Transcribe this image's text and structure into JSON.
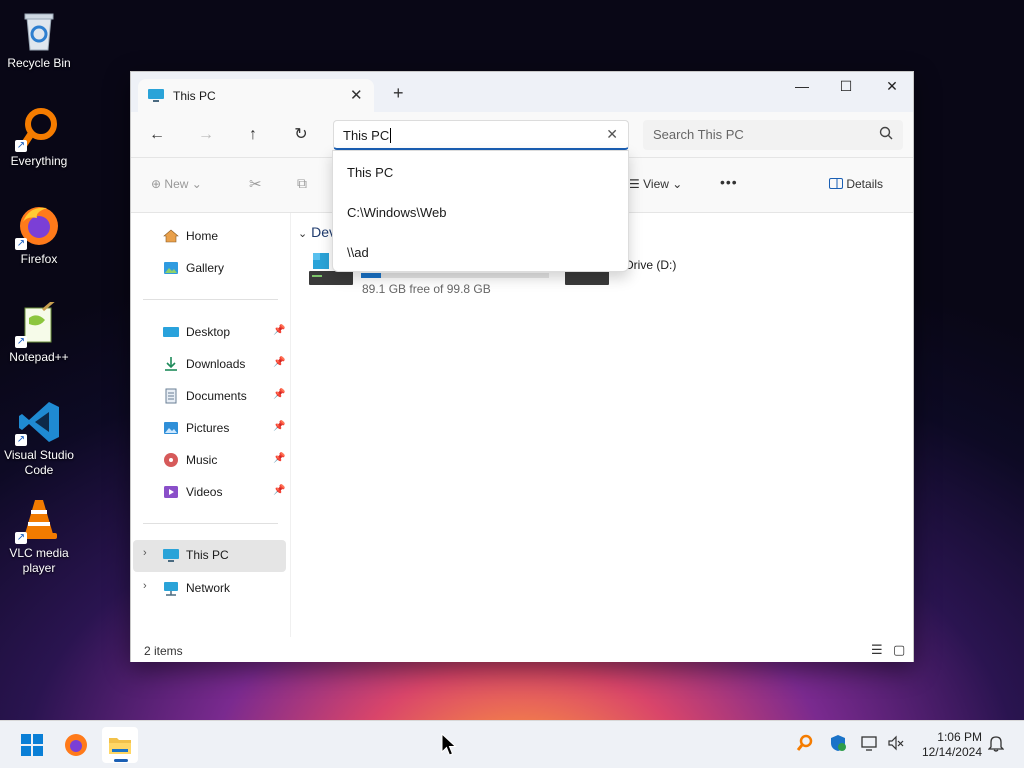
{
  "desktop": {
    "icons": [
      {
        "name": "recycle-bin",
        "label": "Recycle Bin"
      },
      {
        "name": "everything",
        "label": "Everything"
      },
      {
        "name": "firefox",
        "label": "Firefox"
      },
      {
        "name": "notepadpp",
        "label": "Notepad++"
      },
      {
        "name": "vscode",
        "label": "Visual Studio Code"
      },
      {
        "name": "vlc",
        "label": "VLC media player"
      }
    ]
  },
  "window": {
    "tab_title": "This PC",
    "tab_close": "✕",
    "new_tab": "+",
    "controls": {
      "minimize": "—",
      "maximize": "☐",
      "close": "✕"
    },
    "nav": {
      "back": "←",
      "forward": "→",
      "up": "↑",
      "refresh": "↻"
    },
    "address_value": "This PC",
    "address_clear": "✕",
    "search_placeholder": "Search This PC",
    "commands": {
      "new": "New",
      "view": "View",
      "more": "•••",
      "details": "Details"
    },
    "sidebar": {
      "top": [
        {
          "label": "Home",
          "icon": "home-icon"
        },
        {
          "label": "Gallery",
          "icon": "gallery-icon"
        }
      ],
      "pinned": [
        {
          "label": "Desktop",
          "icon": "desktop-folder-icon"
        },
        {
          "label": "Downloads",
          "icon": "downloads-icon"
        },
        {
          "label": "Documents",
          "icon": "documents-icon"
        },
        {
          "label": "Pictures",
          "icon": "pictures-icon"
        },
        {
          "label": "Music",
          "icon": "music-icon"
        },
        {
          "label": "Videos",
          "icon": "videos-icon"
        }
      ],
      "bottom": [
        {
          "label": "This PC",
          "icon": "this-pc-icon",
          "selected": true
        },
        {
          "label": "Network",
          "icon": "network-icon"
        }
      ],
      "pin_glyph": "📌"
    },
    "content": {
      "group_head": "Dev",
      "drive_c_free": "89.1 GB free of 99.8 GB",
      "drive_c_used_fraction": 0.107,
      "drive_d_label": "Drive (D:)"
    },
    "status": {
      "item_count": "2 items"
    },
    "autocomplete": [
      "This PC",
      "C:\\Windows\\Web",
      "\\\\ad"
    ]
  },
  "taskbar": {
    "clock_time": "1:06 PM",
    "clock_date": "12/14/2024"
  },
  "colors": {
    "accent": "#1a5fb4",
    "drive_fill": "#1a73c8",
    "selected_bg": "#e5e5e5"
  }
}
